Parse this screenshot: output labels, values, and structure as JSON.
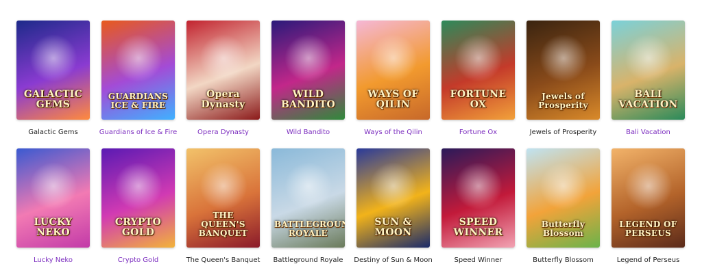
{
  "colors": {
    "link_purple": "#7b2cbf",
    "text_dark": "#222222"
  },
  "games": [
    {
      "title": "Galactic Gems",
      "logo": "GALACTIC GEMS",
      "style": "dark",
      "bg": [
        "#1d2a8a",
        "#8a3bd1",
        "#ff8a3d"
      ]
    },
    {
      "title": "Guardians of Ice & Fire",
      "logo": "GUARDIANS ICE & FIRE",
      "style": "purple",
      "bg": [
        "#e85a1c",
        "#a34bd6",
        "#3fb1ff"
      ]
    },
    {
      "title": "Opera Dynasty",
      "logo": "Opera Dynasty",
      "style": "purple",
      "bg": [
        "#c2232f",
        "#f2d7c4",
        "#8b1a1a"
      ]
    },
    {
      "title": "Wild Bandito",
      "logo": "WILD BANDITO",
      "style": "purple",
      "bg": [
        "#2a1a7a",
        "#c2278a",
        "#2f8a3a"
      ]
    },
    {
      "title": "Ways of the Qilin",
      "logo": "WAYS OF QILIN",
      "style": "purple",
      "bg": [
        "#f5b7d6",
        "#f29a2e",
        "#c7682a"
      ]
    },
    {
      "title": "Fortune Ox",
      "logo": "FORTUNE OX",
      "style": "purple",
      "bg": [
        "#2c8a5a",
        "#c43a2a",
        "#f2a13a"
      ]
    },
    {
      "title": "Jewels of Prosperity",
      "logo": "Jewels of Prosperity",
      "style": "dark",
      "bg": [
        "#3a2410",
        "#8a4b1a",
        "#d98a2a"
      ]
    },
    {
      "title": "Bali Vacation",
      "logo": "BALI VACATION",
      "style": "purple",
      "bg": [
        "#7ad1d9",
        "#d9b36a",
        "#2a8a5a"
      ]
    },
    {
      "title": "Lucky Neko",
      "logo": "LUCKY NEKO",
      "style": "purple",
      "bg": [
        "#3a5ad1",
        "#f27ab3",
        "#c23aa8"
      ]
    },
    {
      "title": "Crypto Gold",
      "logo": "CRYPTO GOLD",
      "style": "purple",
      "bg": [
        "#5a1ab3",
        "#d13ab3",
        "#f2b33a"
      ]
    },
    {
      "title": "The Queen's Banquet",
      "logo": "THE QUEEN'S BANQUET",
      "style": "dark",
      "bg": [
        "#f2c26a",
        "#d9733a",
        "#8a1a2a"
      ]
    },
    {
      "title": "Battleground Royale",
      "logo": "BATTLEGROUND ROYALE",
      "style": "dark",
      "bg": [
        "#8ab9d9",
        "#c9d9e6",
        "#6a7a5a"
      ]
    },
    {
      "title": "Destiny of Sun & Moon",
      "logo": "SUN & MOON",
      "style": "dark",
      "bg": [
        "#2a3a9a",
        "#f2b31a",
        "#1a2a6a"
      ]
    },
    {
      "title": "Speed Winner",
      "logo": "SPEED WINNER",
      "style": "dark",
      "bg": [
        "#2a1a5a",
        "#c21a3a",
        "#f2a3b3"
      ]
    },
    {
      "title": "Butterfly Blossom",
      "logo": "Butterfly Blossom",
      "style": "dark",
      "bg": [
        "#bfe3f2",
        "#f2a33a",
        "#6ab34a"
      ]
    },
    {
      "title": "Legend of Perseus",
      "logo": "LEGEND OF PERSEUS",
      "style": "dark",
      "bg": [
        "#f2b36a",
        "#b3632a",
        "#5a2a1a"
      ]
    }
  ]
}
